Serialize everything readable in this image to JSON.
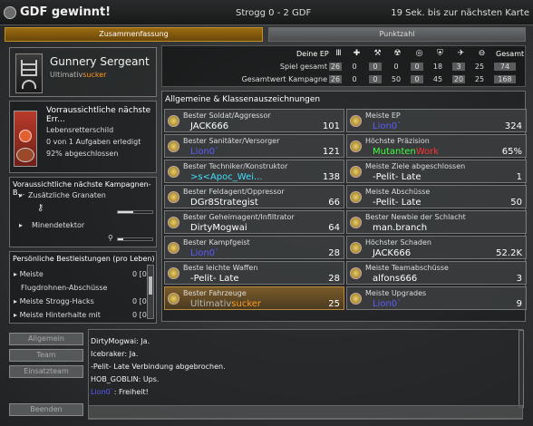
{
  "header": {
    "title": "GDF gewinnt!",
    "score": "Strogg 0 - 2 GDF",
    "next_map": "19 Sek. bis zur nächsten Karte"
  },
  "tabs": [
    {
      "label": "Zusammenfassung",
      "active": true
    },
    {
      "label": "Punktzahl",
      "active": false
    }
  ],
  "rank": {
    "title": "Gunnery Sergeant",
    "player_prefix": "Ultimativ",
    "player_suffix": "sucker"
  },
  "campaign_award": {
    "heading": "Vorraussichtliche nächste Err...",
    "name": "Lebensretterschild",
    "progress": "0 von 1 Aufgaben erledigt",
    "percent": "92% abgeschlossen"
  },
  "next_campaign": {
    "heading": "Voraussichtliche nächste Kampagnen-B...",
    "item1": "Zusätzliche Granaten",
    "item2": "Minendetektor",
    "item1_fill": 0.45,
    "item2_fill": 0.15
  },
  "personal": {
    "heading": "Persönliche Bestleistungen (pro Leben)",
    "rows": [
      {
        "label": "Meiste",
        "value": "0 [0]"
      },
      {
        "label": "Flugdrohnen-Abschüsse",
        "value": ""
      },
      {
        "label": "Meiste Strogg-Hacks",
        "value": "0 [0]"
      },
      {
        "label": "Meiste Hinterhalte mit",
        "value": "0 [0]"
      }
    ]
  },
  "stats": {
    "header_label": "Deine EP",
    "total_label": "Gesamt",
    "row1_label": "Spiel gesamt",
    "row2_label": "Gesamtwert Kampagne",
    "icons": [
      "Ⅲ",
      "✚",
      "⚒",
      "☢",
      "◎",
      "⛨",
      "✈",
      "⊖"
    ],
    "row1": [
      "26",
      "0",
      "0",
      "0",
      "0",
      "18",
      "3",
      "25",
      "74"
    ],
    "row2": [
      "26",
      "0",
      "0",
      "50",
      "0",
      "45",
      "20",
      "25",
      "168"
    ]
  },
  "awards": {
    "heading": "Allgemeine & Klassenauszeichnungen",
    "left": [
      {
        "title": "Bester Soldat/Aggressor",
        "player": "JACK666",
        "value": "101",
        "color": "#ffffff"
      },
      {
        "title": "Bester Sanitäter/Versorger",
        "player": "Lion0`",
        "value": "121",
        "color": "#5c5cff"
      },
      {
        "title": "Bester Techniker/Konstruktor",
        "player": ">s<Apoc_Wei...",
        "value": "138",
        "color": "#40e0ff"
      },
      {
        "title": "Bester Feldagent/Oppressor",
        "player": "DGr8Strategist",
        "value": "66",
        "color": "#ffffff"
      },
      {
        "title": "Bester Geheimagent/Infiltrator",
        "player": "DirtyMogwai",
        "value": "64",
        "color": "#ffffff"
      },
      {
        "title": "Bester Kampfgeist",
        "player": "Lion0`",
        "value": "28",
        "color": "#5c5cff"
      },
      {
        "title": "Beste leichte Waffen",
        "player": "-Pelit- Late",
        "value": "28",
        "color": "#ffffff"
      },
      {
        "title": "Bester Fahrzeuge",
        "player_prefix": "Ultimativ",
        "player_suffix": "sucker",
        "value": "25",
        "highlight": true
      }
    ],
    "right": [
      {
        "title": "Meiste EP",
        "player": "Lion0`",
        "value": "324",
        "color": "#5c5cff"
      },
      {
        "title": "Höchste Präzision",
        "player_prefix": "Mutanten",
        "player_suffix": "Work",
        "value": "65%"
      },
      {
        "title": "Meiste Ziele abgeschlossen",
        "player": "-Pelit- Late",
        "value": "1",
        "color": "#ffffff"
      },
      {
        "title": "Meiste Abschüsse",
        "player": "-Pelit- Late",
        "value": "50",
        "color": "#ffffff"
      },
      {
        "title": "Bester Newbie der Schlacht",
        "player": "man.branch",
        "value": "",
        "color": "#ffffff"
      },
      {
        "title": "Höchster Schaden",
        "player": "JACK666",
        "value": "52.2K",
        "color": "#ffffff"
      },
      {
        "title": "Meiste Teamabschüsse",
        "player": "alfons666",
        "value": "3",
        "color": "#ffffff"
      },
      {
        "title": "Meiste Upgrades",
        "player": "Lion0`",
        "value": "9",
        "color": "#5c5cff"
      }
    ]
  },
  "chat_buttons": {
    "all": "Allgemein",
    "team": "Team",
    "squad": "Einsatzteam",
    "quit": "Beenden"
  },
  "chat": [
    {
      "text": "DirtyMogwai: Ja.",
      "color": "#f2f2f2"
    },
    {
      "text": "Icebraker: Ja.",
      "color": "#f2f2f2"
    },
    {
      "text": "-Pelit- Late Verbindung abgebrochen.",
      "color": "#f2f2f2"
    },
    {
      "text": "HOB_GOBLIN: Ups.",
      "color": "#f2f2f2"
    },
    {
      "name": "Lion0`",
      "message": ": Freiheit!",
      "name_color": "#5c5cff"
    }
  ]
}
